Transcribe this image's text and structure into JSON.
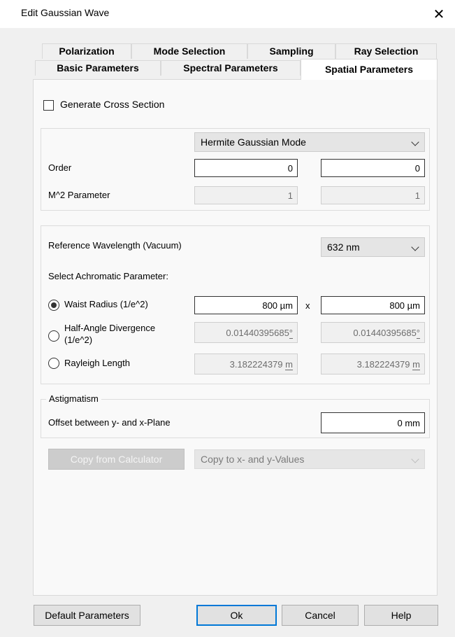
{
  "window": {
    "title": "Edit Gaussian Wave",
    "close_glyph": "✕"
  },
  "tabs": {
    "row1": [
      "Polarization",
      "Mode Selection",
      "Sampling",
      "Ray Selection"
    ],
    "row2": [
      "Basic Parameters",
      "Spectral Parameters",
      "Spatial Parameters"
    ],
    "active": "Spatial Parameters"
  },
  "cross_section": {
    "label": "Generate Cross Section",
    "checked": false
  },
  "mode": {
    "selected": "Hermite Gaussian Mode",
    "order_label": "Order",
    "order_y": "0",
    "order_x": "0",
    "m2_label": "M^2 Parameter",
    "m2_y": "1",
    "m2_x": "1"
  },
  "wavelength": {
    "label": "Reference Wavelength (Vacuum)",
    "value": "632 nm",
    "achromatic_label": "Select Achromatic Parameter:",
    "x_sep": "x",
    "waist": {
      "label": "Waist Radius (1/e^2)",
      "y_num": "800",
      "y_unit": "µm",
      "x_num": "800",
      "x_unit": "µm",
      "selected": true
    },
    "divergence": {
      "label_line1": "Half-Angle Divergence",
      "label_line2": "(1/e^2)",
      "y_num": "0.01440395685",
      "y_unit": "°",
      "x_num": "0.01440395685",
      "x_unit": "°",
      "selected": false
    },
    "rayleigh": {
      "label": "Rayleigh Length",
      "y_num": "3.182224379",
      "y_unit": "m",
      "x_num": "3.182224379",
      "x_unit": "m",
      "selected": false
    }
  },
  "astigmatism": {
    "legend": "Astigmatism",
    "offset_label": "Offset between y- and x-Plane",
    "offset_num": "0",
    "offset_unit": "mm"
  },
  "calculator": {
    "copy_button": "Copy from Calculator",
    "copy_target": "Copy to x- and y-Values"
  },
  "footer": {
    "default_params": "Default Parameters",
    "ok": "Ok",
    "cancel": "Cancel",
    "help": "Help"
  },
  "colors": {
    "focus_border": "#0078d7",
    "dialog_bg": "#f0f0f0",
    "panel_bg": "#f9f9f9"
  }
}
